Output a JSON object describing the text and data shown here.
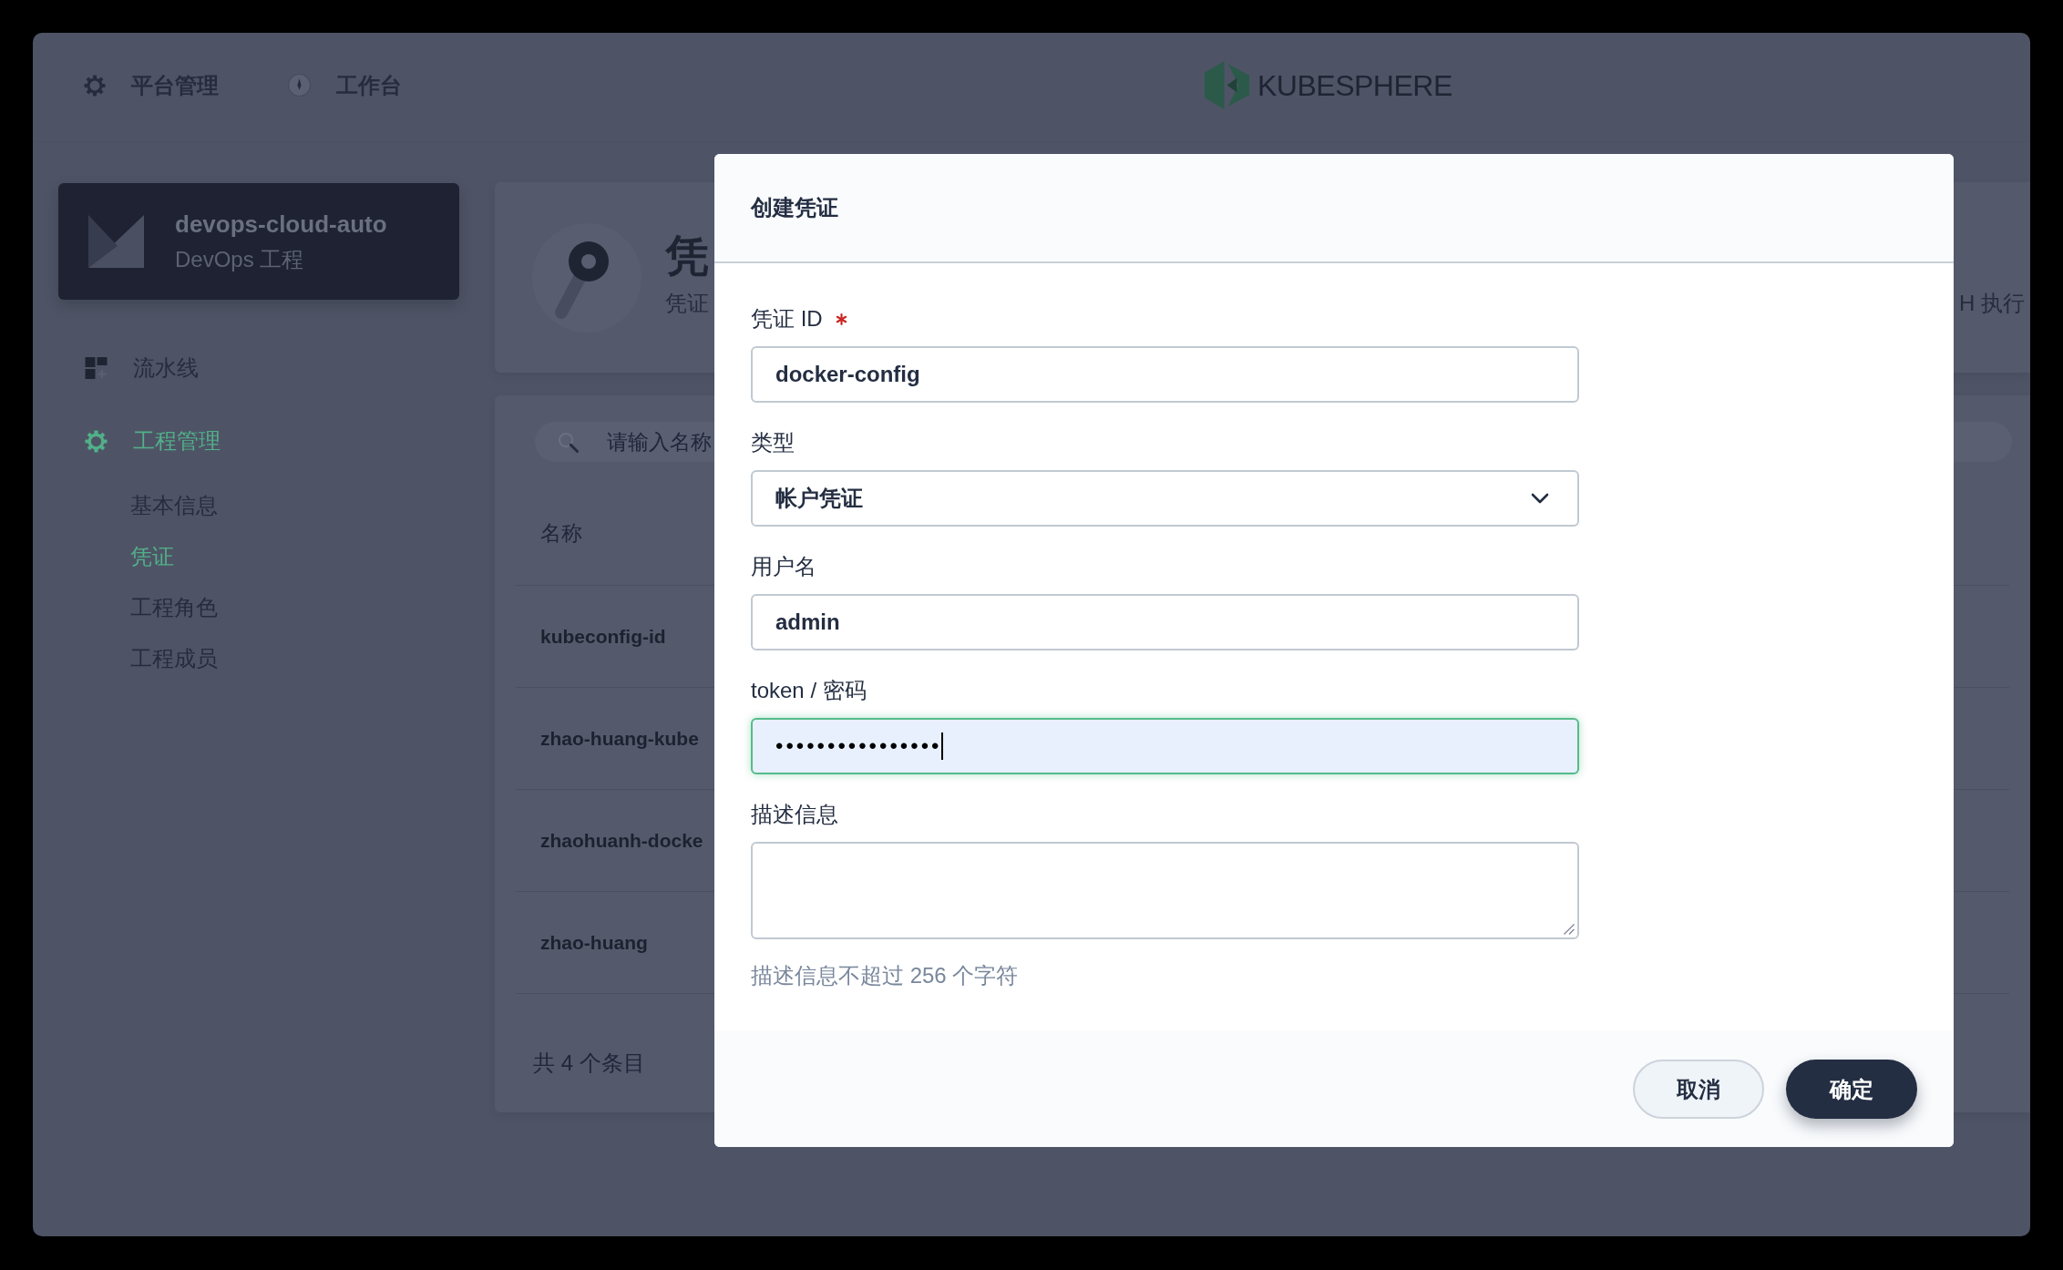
{
  "header": {
    "nav": [
      {
        "kind": "platform",
        "label": "平台管理"
      },
      {
        "kind": "workbench",
        "label": "工作台"
      }
    ],
    "logo": {
      "text": "KUBESPHERE"
    }
  },
  "project_card": {
    "name": "devops-cloud-auto",
    "type": "DevOps 工程"
  },
  "sidebar": {
    "items": [
      {
        "kind": "pipelines",
        "label": "流水线",
        "selected": false
      },
      {
        "kind": "management",
        "label": "工程管理",
        "selected": true,
        "children": [
          {
            "label": "基本信息",
            "selected": false
          },
          {
            "label": "凭证",
            "selected": true
          },
          {
            "label": "工程角色",
            "selected": false
          },
          {
            "label": "工程成员",
            "selected": false
          }
        ]
      }
    ]
  },
  "banner": {
    "title": "凭",
    "description": "凭证",
    "description_tail": "H 执行"
  },
  "credential_list": {
    "search": {
      "placeholder": "请输入名称"
    },
    "columns": [
      "名称"
    ],
    "rows": [
      {
        "name": "kubeconfig-id"
      },
      {
        "name": "zhao-huang-kube"
      },
      {
        "name": "zhaohuanh-docke"
      },
      {
        "name": "zhao-huang"
      }
    ],
    "total": "共 4 个条目"
  },
  "dialog": {
    "title": "创建凭证",
    "fields": [
      {
        "kind": "text",
        "label": "凭证 ID",
        "required": true,
        "value": "docker-config"
      },
      {
        "kind": "select",
        "label": "类型",
        "required": false,
        "value": "帐户凭证"
      },
      {
        "kind": "text",
        "label": "用户名",
        "required": false,
        "value": "admin"
      },
      {
        "kind": "password",
        "label": "token / 密码",
        "required": false,
        "value": "••••••••••••••••",
        "focused": true,
        "autofilled": true
      },
      {
        "kind": "textarea",
        "label": "描述信息",
        "required": false,
        "hint": "描述信息不超过 256 个字符"
      }
    ],
    "buttons": [
      {
        "kind": "secondary",
        "label": "取消"
      },
      {
        "kind": "primary",
        "label": "确定"
      }
    ]
  }
}
